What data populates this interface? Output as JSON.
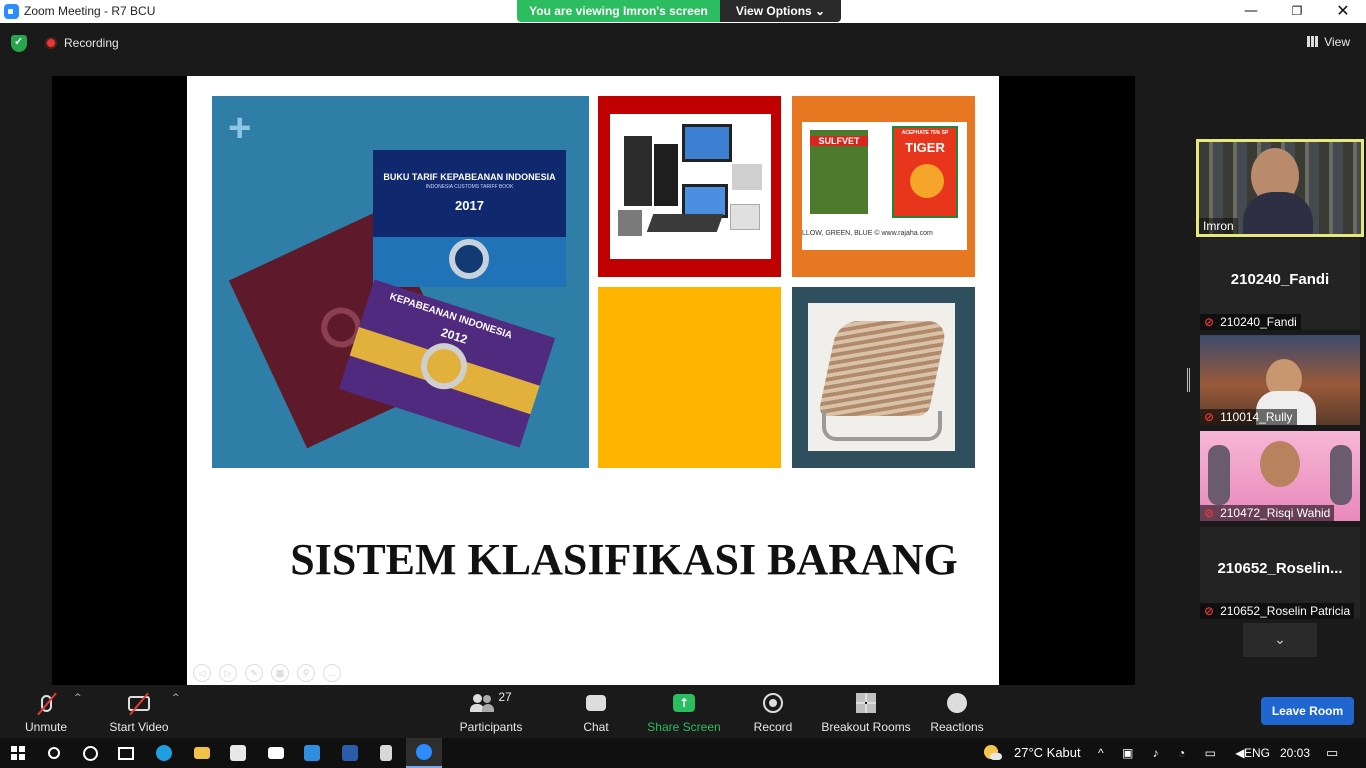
{
  "window": {
    "title": "Zoom Meeting - R7 BCU",
    "minimize_glyph": "—",
    "maximize_glyph": "❐",
    "close_glyph": "✕"
  },
  "banner": {
    "viewing_text": "You are viewing Imron's screen",
    "view_options": "View Options ⌄"
  },
  "topbar": {
    "recording_label": "Recording",
    "view_label": "View"
  },
  "slide": {
    "title": "SISTEM KLASIFIKASI BARANG",
    "book1_title": "BUKU TARIF KEPABEANAN INDONESIA",
    "book1_subtitle": "INDONESIA CUSTOMS TARIFF BOOK",
    "book1_year": "2017",
    "book2_title": "KEPABEANAN INDONESIA",
    "book2_year": "2012",
    "product1_label": "SULFVET",
    "product2_label": "TIGER",
    "product2_sub": "ACEPHATE 75% SP",
    "pesticide_caption": "LLOW, GREEN, BLUE   © www.rajaha.com"
  },
  "participants": [
    {
      "name": "Imron",
      "type": "video-active"
    },
    {
      "display": "210240_Fandi",
      "name": "210240_Fandi",
      "type": "name-only",
      "muted": true
    },
    {
      "name": "110014_Rully",
      "type": "video",
      "muted": true
    },
    {
      "name": "210472_Risqi Wahid",
      "type": "video",
      "muted": true
    },
    {
      "display": "210652_Roselin...",
      "name": "210652_Roselin Patricia",
      "type": "name-only",
      "muted": true
    }
  ],
  "participants_scroll_glyph": "⌄",
  "controls": {
    "unmute": "Unmute",
    "start_video": "Start Video",
    "participants": "Participants",
    "participants_count": "27",
    "chat": "Chat",
    "share_screen": "Share Screen",
    "record": "Record",
    "breakout_rooms": "Breakout Rooms",
    "reactions": "Reactions",
    "leave_room": "Leave Room"
  },
  "taskbar": {
    "weather": "27°C  Kabut",
    "language": "ENG",
    "time": "20:03"
  },
  "colors": {
    "zoom_blue": "#2d8cff",
    "share_green": "#2bbd5f",
    "leave_blue": "#1f66d1",
    "active_speaker_border": "#e6e87a",
    "tile_blue": "#2e7ea8",
    "tile_red": "#c00000",
    "tile_orange": "#e87722",
    "tile_yellow": "#ffb400",
    "tile_navy": "#2f4f5f"
  },
  "icons": [
    "zoom-app-icon",
    "shield-check-icon",
    "recording-dot-icon",
    "grid-view-icon",
    "microphone-muted-icon",
    "camera-off-icon",
    "participants-icon",
    "chat-icon",
    "share-screen-icon",
    "record-icon",
    "breakout-rooms-icon",
    "reactions-icon",
    "windows-start-icon",
    "search-icon",
    "cortana-icon",
    "task-view-icon",
    "edge-icon",
    "file-explorer-icon",
    "store-icon",
    "mail-icon",
    "vscode-icon",
    "word-icon",
    "calculator-icon",
    "zoom-taskbar-icon",
    "weather-icon",
    "notification-icon"
  ]
}
